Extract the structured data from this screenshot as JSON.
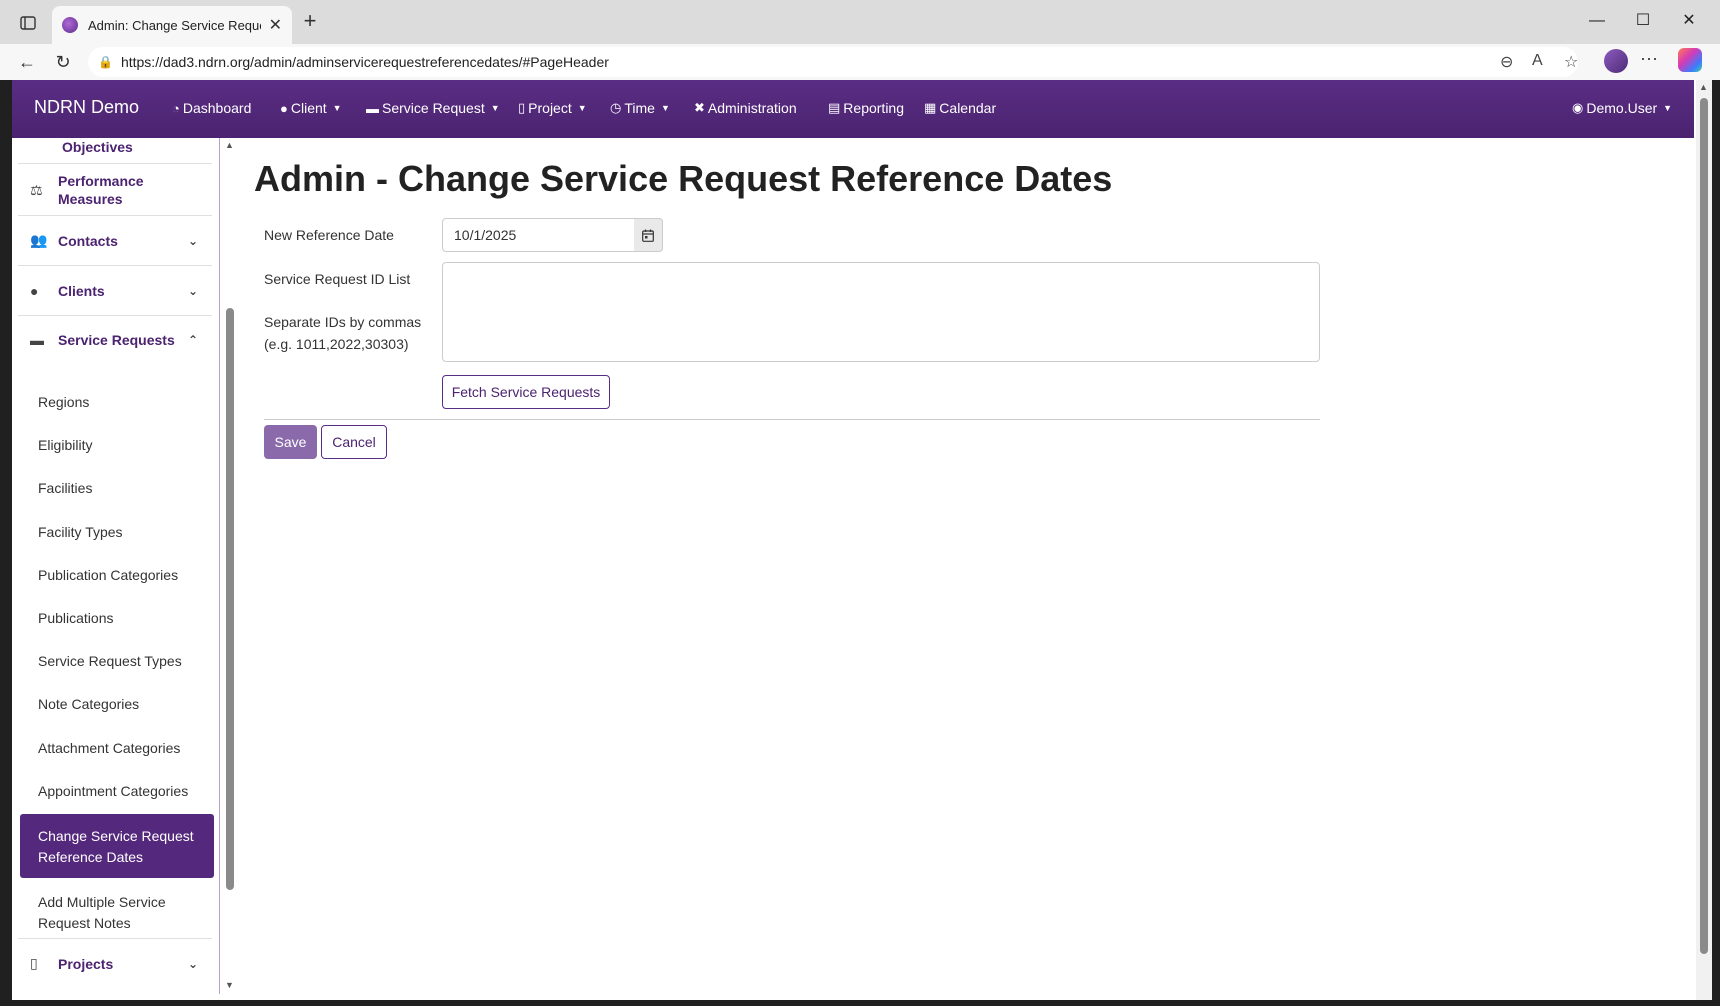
{
  "browser": {
    "tab_title": "Admin: Change Service Request R",
    "url": "https://dad3.ndrn.org/admin/adminservicerequestreferencedates/#PageHeader"
  },
  "app": {
    "brand": "NDRN Demo",
    "nav": [
      {
        "label": "Dashboard",
        "icon": "dashboard-icon"
      },
      {
        "label": "Client",
        "icon": "person-icon"
      },
      {
        "label": "Service Request",
        "icon": "briefcase-icon"
      },
      {
        "label": "Project",
        "icon": "clipboard-icon"
      },
      {
        "label": "Time",
        "icon": "clock-icon"
      },
      {
        "label": "Administration",
        "icon": "tools-icon"
      },
      {
        "label": "Reporting",
        "icon": "document-icon"
      },
      {
        "label": "Calendar",
        "icon": "calendar-icon"
      }
    ],
    "user": "Demo.User"
  },
  "sidebar": {
    "objectives": "Objectives",
    "performance_measures": "Performance Measures",
    "contacts": "Contacts",
    "clients": "Clients",
    "service_requests": "Service Requests",
    "sub_items": [
      "Regions",
      "Eligibility",
      "Facilities",
      "Facility Types",
      "Publication Categories",
      "Publications",
      "Service Request Types",
      "Note Categories",
      "Attachment Categories",
      "Appointment Categories"
    ],
    "active_line1": "Change Service Request",
    "active_line2": "Reference Dates",
    "add_notes_line1": "Add Multiple Service",
    "add_notes_line2": "Request Notes",
    "projects": "Projects"
  },
  "main": {
    "title": "Admin - Change Service Request Reference Dates",
    "new_ref_label": "New Reference Date",
    "new_ref_value": "10/1/2025",
    "id_list_label": "Service Request ID List",
    "id_hint_line1": "Separate IDs by commas",
    "id_hint_line2": "(e.g. 1011,2022,30303)",
    "id_list_value": "",
    "fetch_label": "Fetch Service Requests",
    "save_label": "Save",
    "cancel_label": "Cancel"
  },
  "colors": {
    "brand_purple": "#4b2370",
    "active_item": "#54287c",
    "save_button": "#8b6aac"
  }
}
